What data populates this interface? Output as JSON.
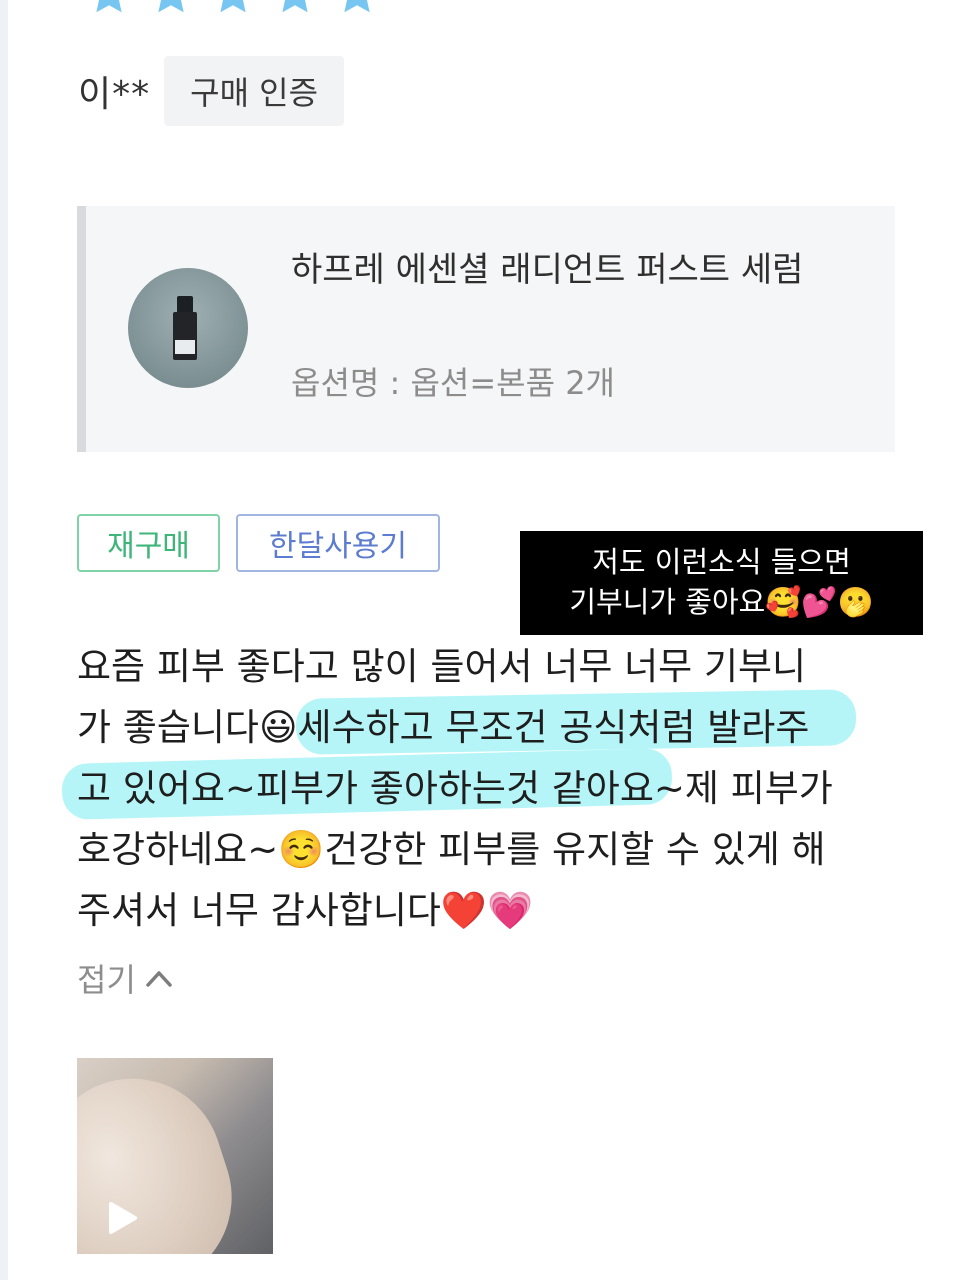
{
  "rating": {
    "stars": 5,
    "max": 5,
    "color": "#77c6f2"
  },
  "reviewer": {
    "name": "이**",
    "badge": "구매 인증"
  },
  "product": {
    "name": "하프레 에센셜 래디언트 퍼스트 세럼",
    "option": "옵션명 : 옵션=본품 2개"
  },
  "tags": [
    "재구매",
    "한달사용기"
  ],
  "caption": {
    "line1": "저도 이런소식 들으면",
    "line2": "기부니가 좋아요🥰💕🫢"
  },
  "review": {
    "lines": [
      "요즘 피부 좋다고 많이 들어서 너무 너무 기부니",
      "가 좋습니다😃세수하고 무조건 공식처럼 발라주",
      "고 있어요~피부가 좋아하는것 같아요~제 피부가",
      "호강하네요~☺️건강한 피부를 유지할 수 있게 해",
      "주셔서 너무 감사합니다❤️💗"
    ],
    "highlight_color": "#78ecf0"
  },
  "fold": {
    "label": "접기",
    "icon": "chevron-up-icon"
  },
  "media": {
    "type": "video",
    "icon": "play-icon"
  }
}
